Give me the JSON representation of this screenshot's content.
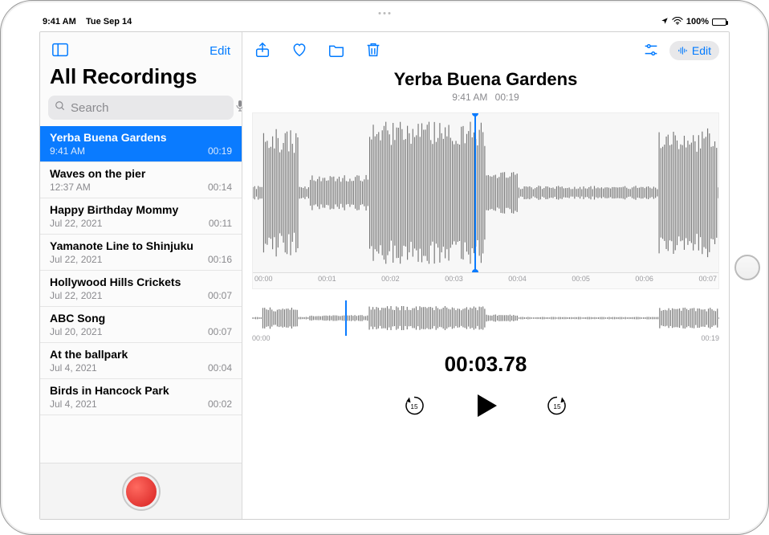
{
  "status": {
    "time": "9:41 AM",
    "date": "Tue Sep 14",
    "battery_pct": "100%"
  },
  "sidebar": {
    "edit_label": "Edit",
    "title": "All Recordings",
    "search_placeholder": "Search",
    "recordings": [
      {
        "name": "Yerba Buena Gardens",
        "sub": "9:41 AM",
        "dur": "00:19",
        "selected": true
      },
      {
        "name": "Waves on the pier",
        "sub": "12:37 AM",
        "dur": "00:14",
        "selected": false
      },
      {
        "name": "Happy Birthday Mommy",
        "sub": "Jul 22, 2021",
        "dur": "00:11",
        "selected": false
      },
      {
        "name": "Yamanote Line to Shinjuku",
        "sub": "Jul 22, 2021",
        "dur": "00:16",
        "selected": false
      },
      {
        "name": "Hollywood Hills Crickets",
        "sub": "Jul 22, 2021",
        "dur": "00:07",
        "selected": false
      },
      {
        "name": "ABC Song",
        "sub": "Jul 20, 2021",
        "dur": "00:07",
        "selected": false
      },
      {
        "name": "At the ballpark",
        "sub": "Jul 4, 2021",
        "dur": "00:04",
        "selected": false
      },
      {
        "name": "Birds in Hancock Park",
        "sub": "Jul 4, 2021",
        "dur": "00:02",
        "selected": false
      }
    ]
  },
  "main": {
    "edit_label": "Edit",
    "title": "Yerba Buena Gardens",
    "sub_time": "9:41 AM",
    "sub_dur": "00:19",
    "axis_big": [
      "00:00",
      "00:01",
      "00:02",
      "00:03",
      "00:04",
      "00:05",
      "00:06",
      "00:07"
    ],
    "axis_small_start": "00:00",
    "axis_small_end": "00:19",
    "timecode": "00:03.78",
    "skip_back_label": "15",
    "skip_fwd_label": "15"
  },
  "colors": {
    "tint": "#007aff",
    "selected": "#0a7bff",
    "record": "#d62020"
  }
}
